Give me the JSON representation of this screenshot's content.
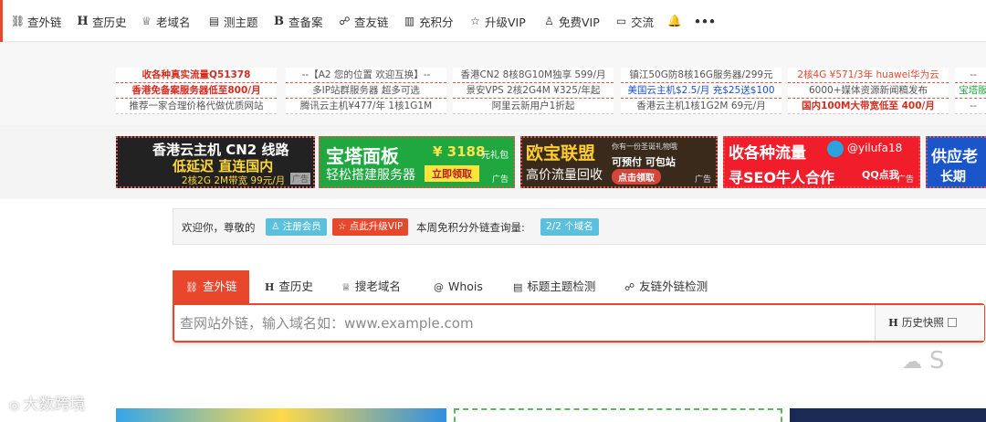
{
  "nav": {
    "items": [
      {
        "icon": "⛓",
        "label": "查外链"
      },
      {
        "icon": "H",
        "label": "查历史"
      },
      {
        "icon": "♕",
        "label": "老域名"
      },
      {
        "icon": "▤",
        "label": "测主题"
      },
      {
        "icon": "B",
        "label": "查备案"
      },
      {
        "icon": "☍",
        "label": "查友链"
      },
      {
        "icon": "▥",
        "label": "充积分"
      },
      {
        "icon": "☆",
        "label": "升级VIP"
      },
      {
        "icon": "♙",
        "label": "免费VIP"
      },
      {
        "icon": "▭",
        "label": "交流"
      }
    ],
    "bell_icon": "🔔",
    "more_icon": "•••"
  },
  "text_ads": [
    {
      "rows": [
        "收各种真实流量Q51378",
        "香港免备案服务器低至800/月",
        "推荐一家合理价格代做优质网站"
      ]
    },
    {
      "rows": [
        "--【A2 您的位置 欢迎互换】--",
        "多IP站群服务器 超多可选",
        "腾讯云主机¥477/年 1核1G1M"
      ]
    },
    {
      "rows": [
        "香港CN2 8核8G10M独享 599/月",
        "景安VPS 2核2G4M ¥325/年起",
        "阿里云新用户1折起"
      ]
    },
    {
      "rows": [
        "镇江50G防8核16G服务器/299元",
        "美国云主机$2.5/月 充$25送$100",
        "香港云主机1核1G2M 69元/月"
      ]
    },
    {
      "rows": [
        "2核4G ¥571/3年 huawei华为云",
        "6000+媒体资源新闻稿发布",
        "国内100M大带宽低至 400/月"
      ]
    },
    {
      "rows": [
        "--",
        "宝塔服",
        "--"
      ]
    }
  ],
  "banners": [
    {
      "line1": "香港云主机 CN2 线路",
      "line2": "低延迟 直连国内",
      "line3": "2核2G 2M带宽  99元/月",
      "tag": "广告"
    },
    {
      "line1": "宝塔面板",
      "price": "¥ 3188",
      "price_sub": "元礼包",
      "line2": "轻松搭建服务器",
      "cta": "立即领取",
      "tag": "广告"
    },
    {
      "line1": "欧宝联盟",
      "small": "你有一份圣诞礼物哦",
      "line2": "高价流量回收",
      "line3": "可预付 可包站",
      "cta": "点击领取",
      "tag": "广告"
    },
    {
      "line1": "收各种流量",
      "handle": "@yilufa18",
      "line2": "寻SEO牛人合作",
      "line3": "QQ点我",
      "tag": "广告"
    },
    {
      "line1": "供应老",
      "line2": "长期"
    }
  ],
  "welcome": {
    "text": "欢迎你，尊敬的",
    "register": "注册会员",
    "upgrade": "点此升级VIP",
    "quota_label": "本周免积分外链查询量:",
    "quota_value": "2/2 个域名"
  },
  "search": {
    "tabs": [
      {
        "icon": "⛓",
        "label": "查外链"
      },
      {
        "icon": "H",
        "label": "查历史"
      },
      {
        "icon": "♕",
        "label": "搜老域名"
      },
      {
        "icon": "@",
        "label": "Whois"
      },
      {
        "icon": "▤",
        "label": "标题主题检测"
      },
      {
        "icon": "☍",
        "label": "友链外链检测"
      }
    ],
    "placeholder": "查网站外链，输入域名如：www.example.com",
    "history_icon": "H",
    "history_label": "历史快照"
  },
  "watermark": {
    "left": "大数跨境",
    "right": "S"
  }
}
